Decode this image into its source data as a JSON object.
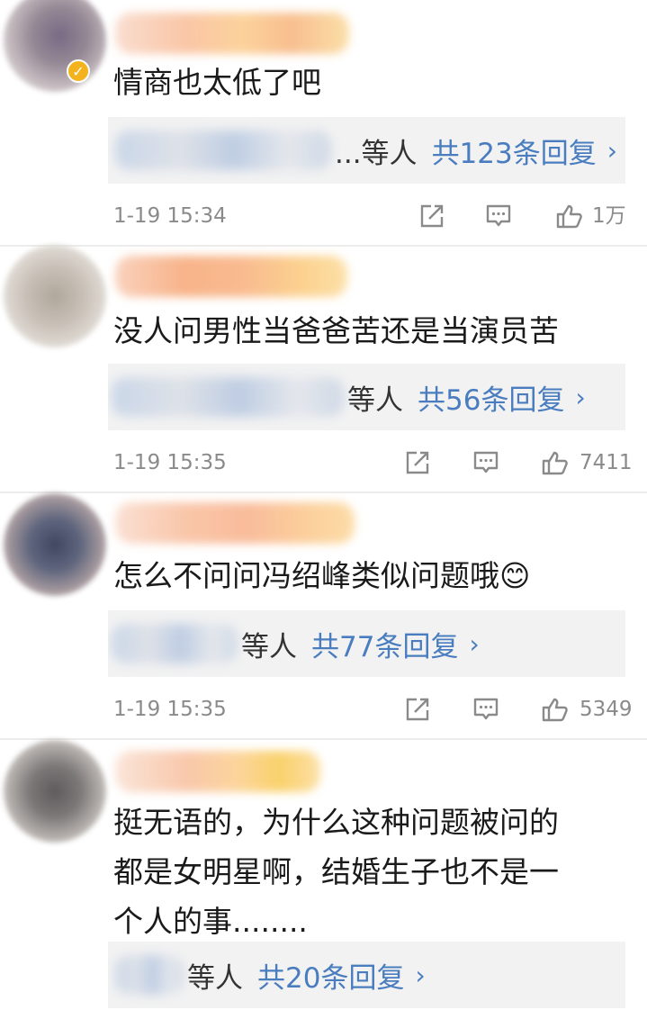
{
  "comments": [
    {
      "text": "情商也太低了吧",
      "replies_by": "...等人",
      "replies_count": "共123条回复",
      "time": "1-19 15:34",
      "likes": "1万",
      "verified": true
    },
    {
      "text": "没人问男性当爸爸苦还是当演员苦",
      "replies_by": "等人",
      "replies_count": "共56条回复",
      "time": "1-19 15:35",
      "likes": "7411"
    },
    {
      "text": "怎么不问问冯绍峰类似问题哦😊",
      "replies_by": "等人",
      "replies_count": "共77条回复",
      "time": "1-19 15:35",
      "likes": "5349"
    },
    {
      "text": "挺无语的，为什么这种问题被问的\n都是女明星啊，结婚生子也不是一\n个人的事........",
      "replies_by": "等人",
      "replies_count": "共20条回复"
    }
  ],
  "icons": {
    "share": "share-icon",
    "reply": "comment-icon",
    "like": "thumbs-up-icon",
    "chevron": "chevron-right-icon",
    "chevron_glyph": "›",
    "badge_glyph": "✓"
  },
  "colors": {
    "link": "#4a7dbf",
    "meta": "#8a8a8a",
    "reply_bg": "#f2f2f2",
    "verified_badge": "#f3b31f"
  }
}
